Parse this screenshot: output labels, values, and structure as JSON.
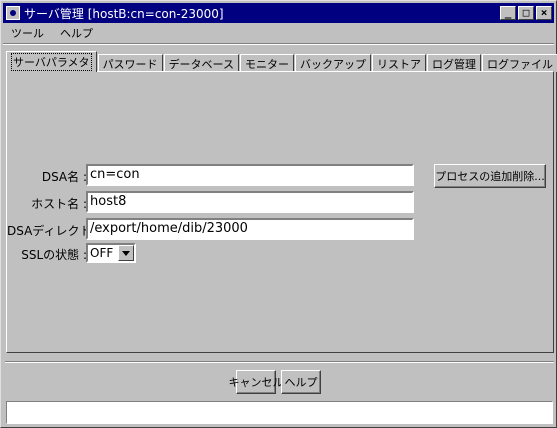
{
  "window": {
    "title": "サーバ管理 [hostB:cn=con-23000]",
    "buttons": {
      "minimize": "_",
      "maximize": "□",
      "close": "×"
    }
  },
  "menu": [
    "ツール",
    "ヘルプ"
  ],
  "tabs": [
    {
      "label": "サーバパラメタ",
      "active": true
    },
    {
      "label": "パスワード"
    },
    {
      "label": "データベース"
    },
    {
      "label": "モニター"
    },
    {
      "label": "バックアップ"
    },
    {
      "label": "リストア"
    },
    {
      "label": "ログ管理"
    },
    {
      "label": "ログファイル"
    }
  ],
  "form": {
    "dsa_name": {
      "label": "DSA名 :",
      "value": "cn=con"
    },
    "host_name": {
      "label": "ホスト名 :",
      "value": "host8"
    },
    "dsa_dir": {
      "label": "DSAディレクトリ :",
      "value": "/export/home/dib/23000"
    },
    "ssl": {
      "label": "SSLの状態 :",
      "value": "OFF"
    },
    "process_button": "プロセスの追加削除..."
  },
  "footer": {
    "cancel": "キャンセル",
    "help": "ヘルプ"
  },
  "status": {
    "text": ""
  }
}
